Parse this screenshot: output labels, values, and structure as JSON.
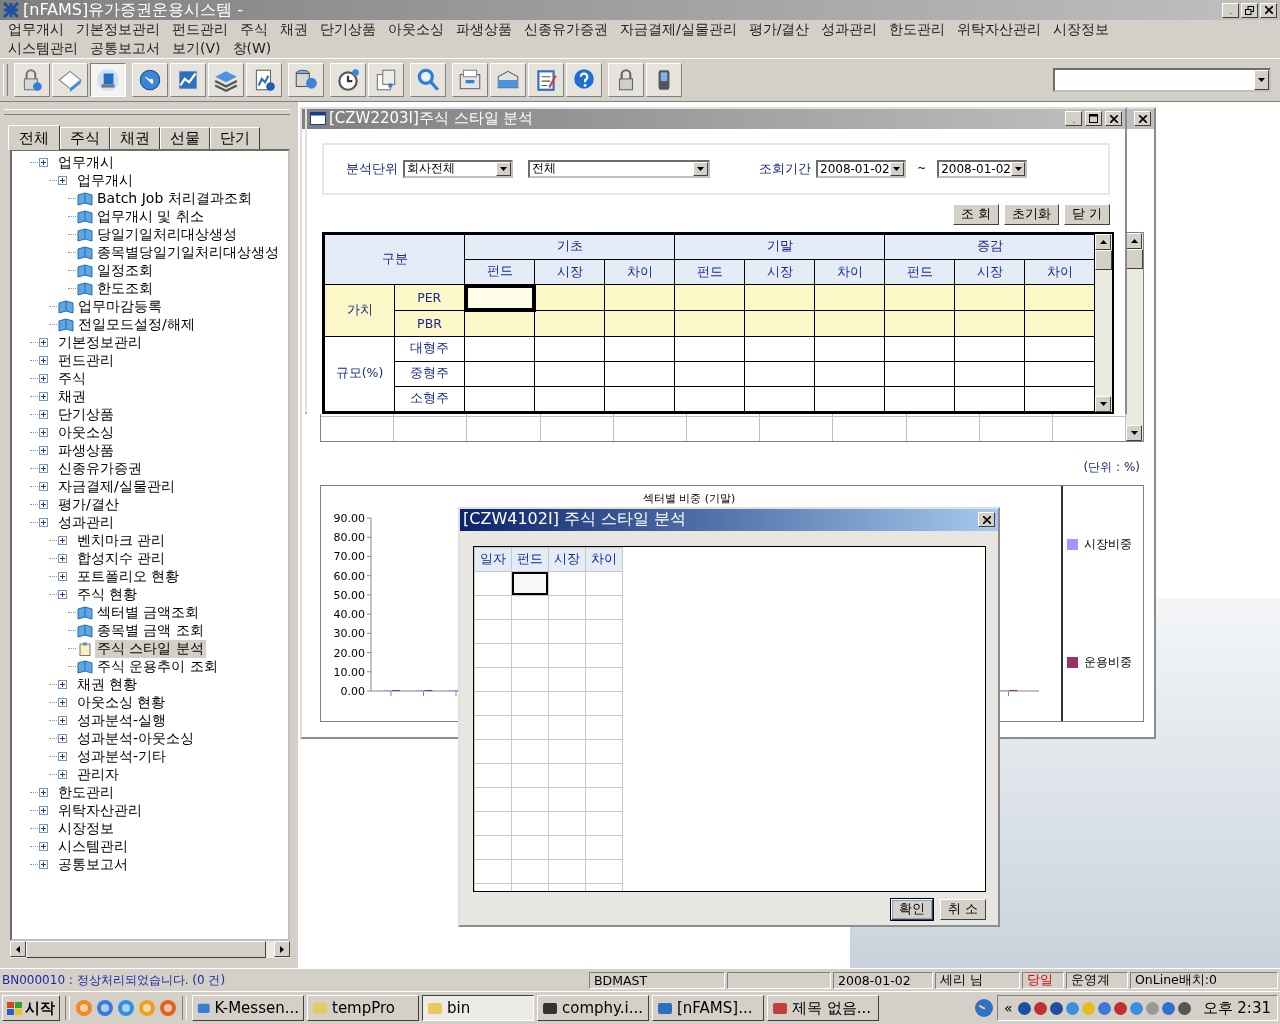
{
  "app_title": "[nFAMS]유가증권운용시스템 -",
  "menu_rows": [
    [
      "업무개시",
      "기본정보관리",
      "펀드관리",
      "주식",
      "채권",
      "단기상품",
      "아웃소싱",
      "파생상품",
      "신종유가증권",
      "자금결제/실물관리",
      "평가/결산",
      "성과관리",
      "한도관리",
      "위탁자산관리",
      "시장정보"
    ],
    [
      "시스템관리",
      "공통보고서",
      "보기(V)",
      "창(W)"
    ]
  ],
  "toolbar": {
    "groups": [
      [
        {
          "pressed": false
        },
        {
          "pressed": false
        },
        {
          "pressed": true
        }
      ],
      [
        {
          "pressed": false
        },
        {
          "pressed": false
        },
        {
          "pressed": false
        },
        {
          "pressed": false
        }
      ],
      [
        {
          "pressed": false
        }
      ],
      [
        {
          "pressed": false
        },
        {
          "pressed": false
        }
      ],
      [
        {
          "pressed": false
        }
      ],
      [
        {
          "pressed": false
        },
        {
          "pressed": false
        },
        {
          "pressed": false
        },
        {
          "pressed": false
        }
      ],
      [
        {
          "pressed": false
        },
        {
          "pressed": false
        }
      ]
    ]
  },
  "sidebar": {
    "tabs": [
      {
        "label": "전체",
        "selected": true
      },
      {
        "label": "주식",
        "selected": false
      },
      {
        "label": "채권",
        "selected": false
      },
      {
        "label": "선물",
        "selected": false
      },
      {
        "label": "단기",
        "selected": false
      }
    ],
    "tree": [
      {
        "label": "업무개시",
        "kind": "folder",
        "selected": false,
        "children": [
          {
            "label": "업무개시",
            "kind": "folder",
            "selected": false,
            "children": [
              {
                "label": "Batch Job 처리결과조회",
                "kind": "leaf",
                "selected": false
              },
              {
                "label": "업무개시 및 취소",
                "kind": "leaf",
                "selected": false
              },
              {
                "label": "당일기일처리대상생성",
                "kind": "leaf",
                "selected": false
              },
              {
                "label": "종목별당일기일처리대상생성",
                "kind": "leaf",
                "selected": false
              },
              {
                "label": "일정조회",
                "kind": "leaf",
                "selected": false
              },
              {
                "label": "한도조회",
                "kind": "leaf",
                "selected": false
              }
            ]
          },
          {
            "label": "업무마감등록",
            "kind": "leaf",
            "selected": false
          },
          {
            "label": "전일모드설정/해제",
            "kind": "leaf",
            "selected": false
          }
        ]
      },
      {
        "label": "기본정보관리",
        "kind": "folder",
        "selected": false
      },
      {
        "label": "펀드관리",
        "kind": "folder",
        "selected": false
      },
      {
        "label": "주식",
        "kind": "folder",
        "selected": false
      },
      {
        "label": "채권",
        "kind": "folder",
        "selected": false
      },
      {
        "label": "단기상품",
        "kind": "folder",
        "selected": false
      },
      {
        "label": "아웃소싱",
        "kind": "folder",
        "selected": false
      },
      {
        "label": "파생상품",
        "kind": "folder",
        "selected": false
      },
      {
        "label": "신종유가증권",
        "kind": "folder",
        "selected": false
      },
      {
        "label": "자금결제/실물관리",
        "kind": "folder",
        "selected": false
      },
      {
        "label": "평가/결산",
        "kind": "folder",
        "selected": false
      },
      {
        "label": "성과관리",
        "kind": "folder",
        "selected": false,
        "children": [
          {
            "label": "벤치마크 관리",
            "kind": "folder",
            "selected": false
          },
          {
            "label": "합성지수 관리",
            "kind": "folder",
            "selected": false
          },
          {
            "label": "포트폴리오 현황",
            "kind": "folder",
            "selected": false
          },
          {
            "label": "주식 현황",
            "kind": "folder",
            "selected": false,
            "children": [
              {
                "label": "섹터별 금액조회",
                "kind": "leaf",
                "selected": false
              },
              {
                "label": "종목별 금액 조회",
                "kind": "leaf",
                "selected": false
              },
              {
                "label": "주식 스타일 분석",
                "kind": "leaf",
                "selected": true
              },
              {
                "label": "주식 운용추이 조회",
                "kind": "leaf",
                "selected": false
              }
            ]
          },
          {
            "label": "채권 현황",
            "kind": "folder",
            "selected": false
          },
          {
            "label": "아웃소싱 현황",
            "kind": "folder",
            "selected": false
          },
          {
            "label": "성과분석-실행",
            "kind": "folder",
            "selected": false
          },
          {
            "label": "성과분석-아웃소싱",
            "kind": "folder",
            "selected": false
          },
          {
            "label": "성과분석-기타",
            "kind": "folder",
            "selected": false
          },
          {
            "label": "관리자",
            "kind": "folder",
            "selected": false
          }
        ]
      },
      {
        "label": "한도관리",
        "kind": "folder",
        "selected": false
      },
      {
        "label": "위탁자산관리",
        "kind": "folder",
        "selected": false
      },
      {
        "label": "시장정보",
        "kind": "folder",
        "selected": false
      },
      {
        "label": "시스템관리",
        "kind": "folder",
        "selected": false
      },
      {
        "label": "공통보고서",
        "kind": "folder",
        "selected": false
      }
    ]
  },
  "back_window": {
    "unit_label": "(단위 : %)",
    "chart_data": {
      "type": "bar",
      "title": "섹터별 비중 (기말)",
      "ylim": [
        0,
        90
      ],
      "yticks": [
        {
          "value": 0,
          "label": "0.00"
        },
        {
          "value": 10,
          "label": "10.00"
        },
        {
          "value": 20,
          "label": "20.00"
        },
        {
          "value": 30,
          "label": "30.00"
        },
        {
          "value": 40,
          "label": "40.00"
        },
        {
          "value": 50,
          "label": "50.00"
        },
        {
          "value": 60,
          "label": "60.00"
        },
        {
          "value": 70,
          "label": "70.00"
        },
        {
          "value": 80,
          "label": "80.00"
        },
        {
          "value": 90,
          "label": "90.00"
        }
      ],
      "series": [
        {
          "name": "시장비중",
          "color": "#9999ff",
          "values": [
            0,
            0,
            0,
            0,
            0,
            0,
            0,
            0,
            0,
            0,
            0,
            0,
            0,
            0,
            0,
            0,
            0,
            0,
            0,
            0
          ]
        },
        {
          "name": "운용비중",
          "color": "#993366",
          "values": [
            0,
            0,
            0,
            0,
            0,
            0,
            0,
            0,
            0,
            0,
            0,
            0,
            0,
            0,
            0,
            0,
            0,
            0,
            0,
            0
          ]
        }
      ]
    }
  },
  "front_window": {
    "title": "[CZW2203I]주식 스타일 분석",
    "filters": {
      "unit_label": "분석단위",
      "unit_value": "회사전체",
      "scope_value": "전체",
      "period_label": "조회기간",
      "date_from": "2008-01-02",
      "separator": "~",
      "date_to": "2008-01-02"
    },
    "buttons": [
      "조 회",
      "초기화",
      "닫 기"
    ],
    "grid": {
      "corner_label": "구분",
      "groups": [
        {
          "label": "기초",
          "columns": [
            "펀드",
            "시장",
            "차이"
          ]
        },
        {
          "label": "기말",
          "columns": [
            "펀드",
            "시장",
            "차이"
          ]
        },
        {
          "label": "증감",
          "columns": [
            "펀드",
            "시장",
            "차이"
          ]
        }
      ],
      "row_groups": [
        {
          "label": "가치",
          "highlight": true,
          "rows": [
            {
              "label": "PER",
              "cells": [
                {
                  "selected": true
                },
                {
                  "selected": false
                },
                {
                  "selected": false
                },
                {
                  "selected": false
                },
                {
                  "selected": false
                },
                {
                  "selected": false
                },
                {
                  "selected": false
                },
                {
                  "selected": false
                },
                {
                  "selected": false
                }
              ]
            },
            {
              "label": "PBR",
              "cells": [
                {
                  "selected": false
                },
                {
                  "selected": false
                },
                {
                  "selected": false
                },
                {
                  "selected": false
                },
                {
                  "selected": false
                },
                {
                  "selected": false
                },
                {
                  "selected": false
                },
                {
                  "selected": false
                },
                {
                  "selected": false
                }
              ]
            }
          ]
        },
        {
          "label": "규모(%)",
          "highlight": false,
          "rows": [
            {
              "label": "대형주",
              "cells": [
                {
                  "selected": false
                },
                {
                  "selected": false
                },
                {
                  "selected": false
                },
                {
                  "selected": false
                },
                {
                  "selected": false
                },
                {
                  "selected": false
                },
                {
                  "selected": false
                },
                {
                  "selected": false
                },
                {
                  "selected": false
                }
              ]
            },
            {
              "label": "중형주",
              "cells": [
                {
                  "selected": false
                },
                {
                  "selected": false
                },
                {
                  "selected": false
                },
                {
                  "selected": false
                },
                {
                  "selected": false
                },
                {
                  "selected": false
                },
                {
                  "selected": false
                },
                {
                  "selected": false
                },
                {
                  "selected": false
                }
              ]
            },
            {
              "label": "소형주",
              "cells": [
                {
                  "selected": false
                },
                {
                  "selected": false
                },
                {
                  "selected": false
                },
                {
                  "selected": false
                },
                {
                  "selected": false
                },
                {
                  "selected": false
                },
                {
                  "selected": false
                },
                {
                  "selected": false
                },
                {
                  "selected": false
                }
              ]
            }
          ]
        }
      ]
    }
  },
  "dialog": {
    "title": "[CZW4102I] 주식 스타일 분석",
    "columns": [
      "일자",
      "펀드",
      "시장",
      "차이"
    ],
    "rows": [
      {
        "cells": [
          {
            "selected": false
          },
          {
            "selected": true
          },
          {
            "selected": false
          },
          {
            "selected": false
          }
        ]
      },
      {
        "cells": [
          {
            "selected": false
          },
          {
            "selected": false
          },
          {
            "selected": false
          },
          {
            "selected": false
          }
        ]
      },
      {
        "cells": [
          {
            "selected": false
          },
          {
            "selected": false
          },
          {
            "selected": false
          },
          {
            "selected": false
          }
        ]
      },
      {
        "cells": [
          {
            "selected": false
          },
          {
            "selected": false
          },
          {
            "selected": false
          },
          {
            "selected": false
          }
        ]
      },
      {
        "cells": [
          {
            "selected": false
          },
          {
            "selected": false
          },
          {
            "selected": false
          },
          {
            "selected": false
          }
        ]
      },
      {
        "cells": [
          {
            "selected": false
          },
          {
            "selected": false
          },
          {
            "selected": false
          },
          {
            "selected": false
          }
        ]
      },
      {
        "cells": [
          {
            "selected": false
          },
          {
            "selected": false
          },
          {
            "selected": false
          },
          {
            "selected": false
          }
        ]
      },
      {
        "cells": [
          {
            "selected": false
          },
          {
            "selected": false
          },
          {
            "selected": false
          },
          {
            "selected": false
          }
        ]
      },
      {
        "cells": [
          {
            "selected": false
          },
          {
            "selected": false
          },
          {
            "selected": false
          },
          {
            "selected": false
          }
        ]
      },
      {
        "cells": [
          {
            "selected": false
          },
          {
            "selected": false
          },
          {
            "selected": false
          },
          {
            "selected": false
          }
        ]
      },
      {
        "cells": [
          {
            "selected": false
          },
          {
            "selected": false
          },
          {
            "selected": false
          },
          {
            "selected": false
          }
        ]
      },
      {
        "cells": [
          {
            "selected": false
          },
          {
            "selected": false
          },
          {
            "selected": false
          },
          {
            "selected": false
          }
        ]
      },
      {
        "cells": [
          {
            "selected": false
          },
          {
            "selected": false
          },
          {
            "selected": false
          },
          {
            "selected": false
          }
        ]
      },
      {
        "cells": [
          {
            "selected": false
          },
          {
            "selected": false
          },
          {
            "selected": false
          },
          {
            "selected": false
          }
        ]
      }
    ],
    "buttons": [
      {
        "label": "확인",
        "focused": true
      },
      {
        "label": "취 소",
        "focused": false
      }
    ]
  },
  "status_bar": {
    "message": "BN000010 : 정상처리되었습니다. (0 건)",
    "panes": [
      {
        "text": "BDMAST",
        "alert": false
      },
      {
        "text": "2008-01-02",
        "alert": false
      },
      {
        "text": "세리 님",
        "alert": false
      },
      {
        "text": "당일",
        "alert": true
      },
      {
        "text": "운영계",
        "alert": false
      },
      {
        "text": "OnLine배치:0",
        "alert": false
      }
    ]
  },
  "taskbar": {
    "start_label": "시작",
    "tasks": [
      {
        "label": "K-Messen...",
        "selected": false
      },
      {
        "label": "tempPro",
        "selected": false
      },
      {
        "label": "bin",
        "selected": true
      },
      {
        "label": "comphy.i...",
        "selected": false
      },
      {
        "label": "[nFAMS]...",
        "selected": false
      },
      {
        "label": "제목 없음...",
        "selected": false
      }
    ],
    "tray_chevron": "«",
    "clock": "오후 2:31"
  }
}
